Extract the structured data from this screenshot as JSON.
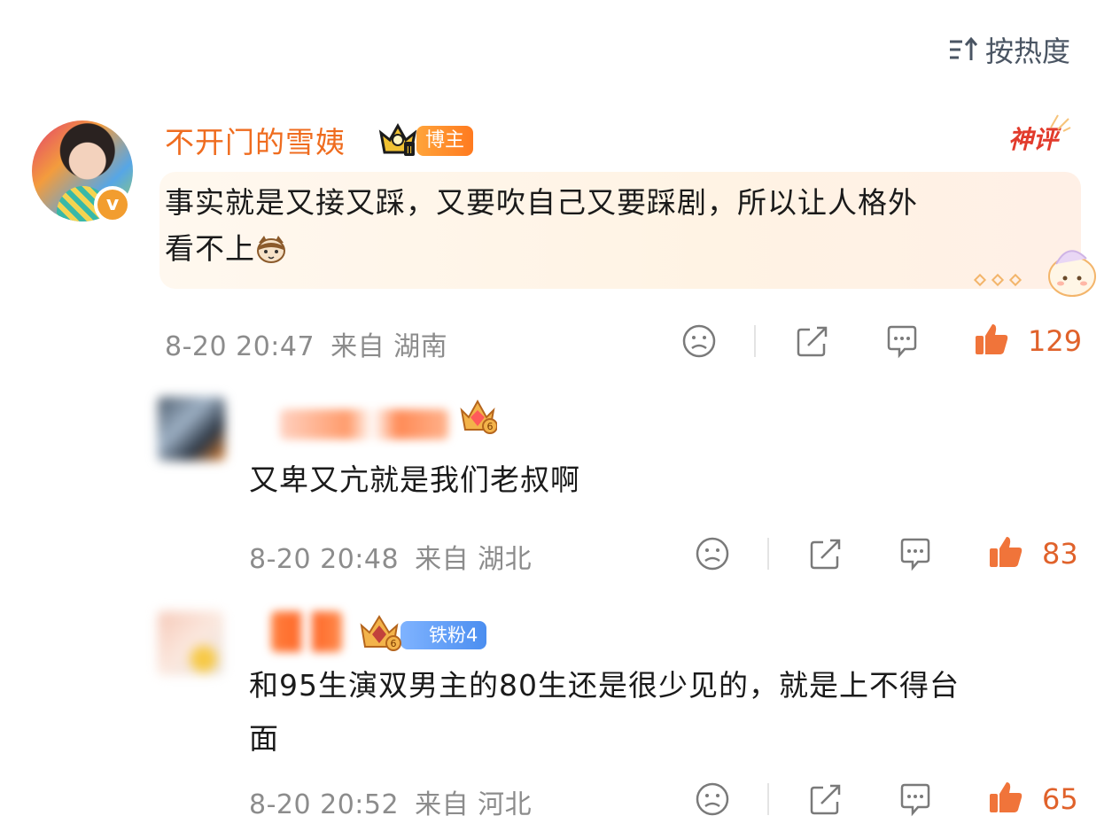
{
  "sort": {
    "label": "按热度",
    "icon": "sort-icon"
  },
  "main_comment": {
    "username": "不开门的雪姨",
    "badge_label": "博主",
    "featured_label": "神评",
    "text_line1": "事实就是又接又踩，又要吹自己又要踩剧，所以让人格外",
    "text_line2": "看不上",
    "date": "8-20 20:47",
    "location": "来自 湖南",
    "likes": "129",
    "colors": {
      "username": "#ef6c1f",
      "like": "#e0622b",
      "featured": "#e23b2c"
    }
  },
  "replies": [
    {
      "username": "",
      "text": "又卑又亢就是我们老叔啊",
      "date": "8-20 20:48",
      "location": "来自 湖北",
      "likes": "83"
    },
    {
      "username": "",
      "fan_badge": "铁粉4",
      "text_line1": "和95生演双男主的80生还是很少见的，就是上不得台",
      "text_line2": "面",
      "date": "8-20 20:52",
      "location": "来自 河北",
      "likes": "65"
    }
  ]
}
